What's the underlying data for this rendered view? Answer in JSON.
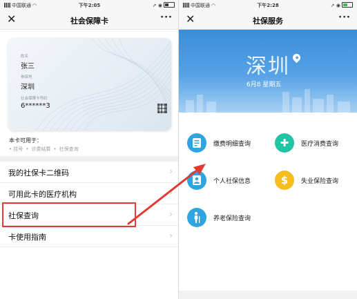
{
  "left": {
    "status": {
      "carrier": "中国联通",
      "time": "下午2:05"
    },
    "nav": {
      "close": "✕",
      "title": "社会保障卡",
      "more": "···"
    },
    "card": {
      "name_label": "姓名",
      "name": "张三",
      "region_label": "参保地",
      "region": "深圳",
      "number_label": "社会保障卡号码",
      "number": "6******3"
    },
    "usage": {
      "title": "本卡可用于：",
      "items": [
        "挂号",
        "诊费结算",
        "社保查询"
      ]
    },
    "list": [
      {
        "label": "我的社保卡二维码"
      },
      {
        "label": "可用此卡的医疗机构"
      },
      {
        "label": "社保查询",
        "highlighted": true
      },
      {
        "label": "卡使用指南"
      }
    ],
    "battery_level": 0.45
  },
  "right": {
    "status": {
      "carrier": "中国联通",
      "time": "下午2:28"
    },
    "nav": {
      "close": "✕",
      "title": "社保服务",
      "more": "···"
    },
    "banner": {
      "city": "深圳",
      "date": "6月8  星期五"
    },
    "services": [
      {
        "label": "缴费明细查询",
        "icon": "payment-detail-icon",
        "color": "#2ea4e0"
      },
      {
        "label": "医疗消费查询",
        "icon": "medical-cross-icon",
        "color": "#23c4a6"
      },
      {
        "label": "个人社保信息",
        "icon": "person-info-icon",
        "color": "#2ea4e0"
      },
      {
        "label": "失业保险查询",
        "icon": "dollar-icon",
        "color": "#f5bd1f"
      },
      {
        "label": "养老保险查询",
        "icon": "elderly-icon",
        "color": "#2ea4e0"
      }
    ],
    "battery_level": 0.55
  },
  "annotation_color": "#e13a34"
}
